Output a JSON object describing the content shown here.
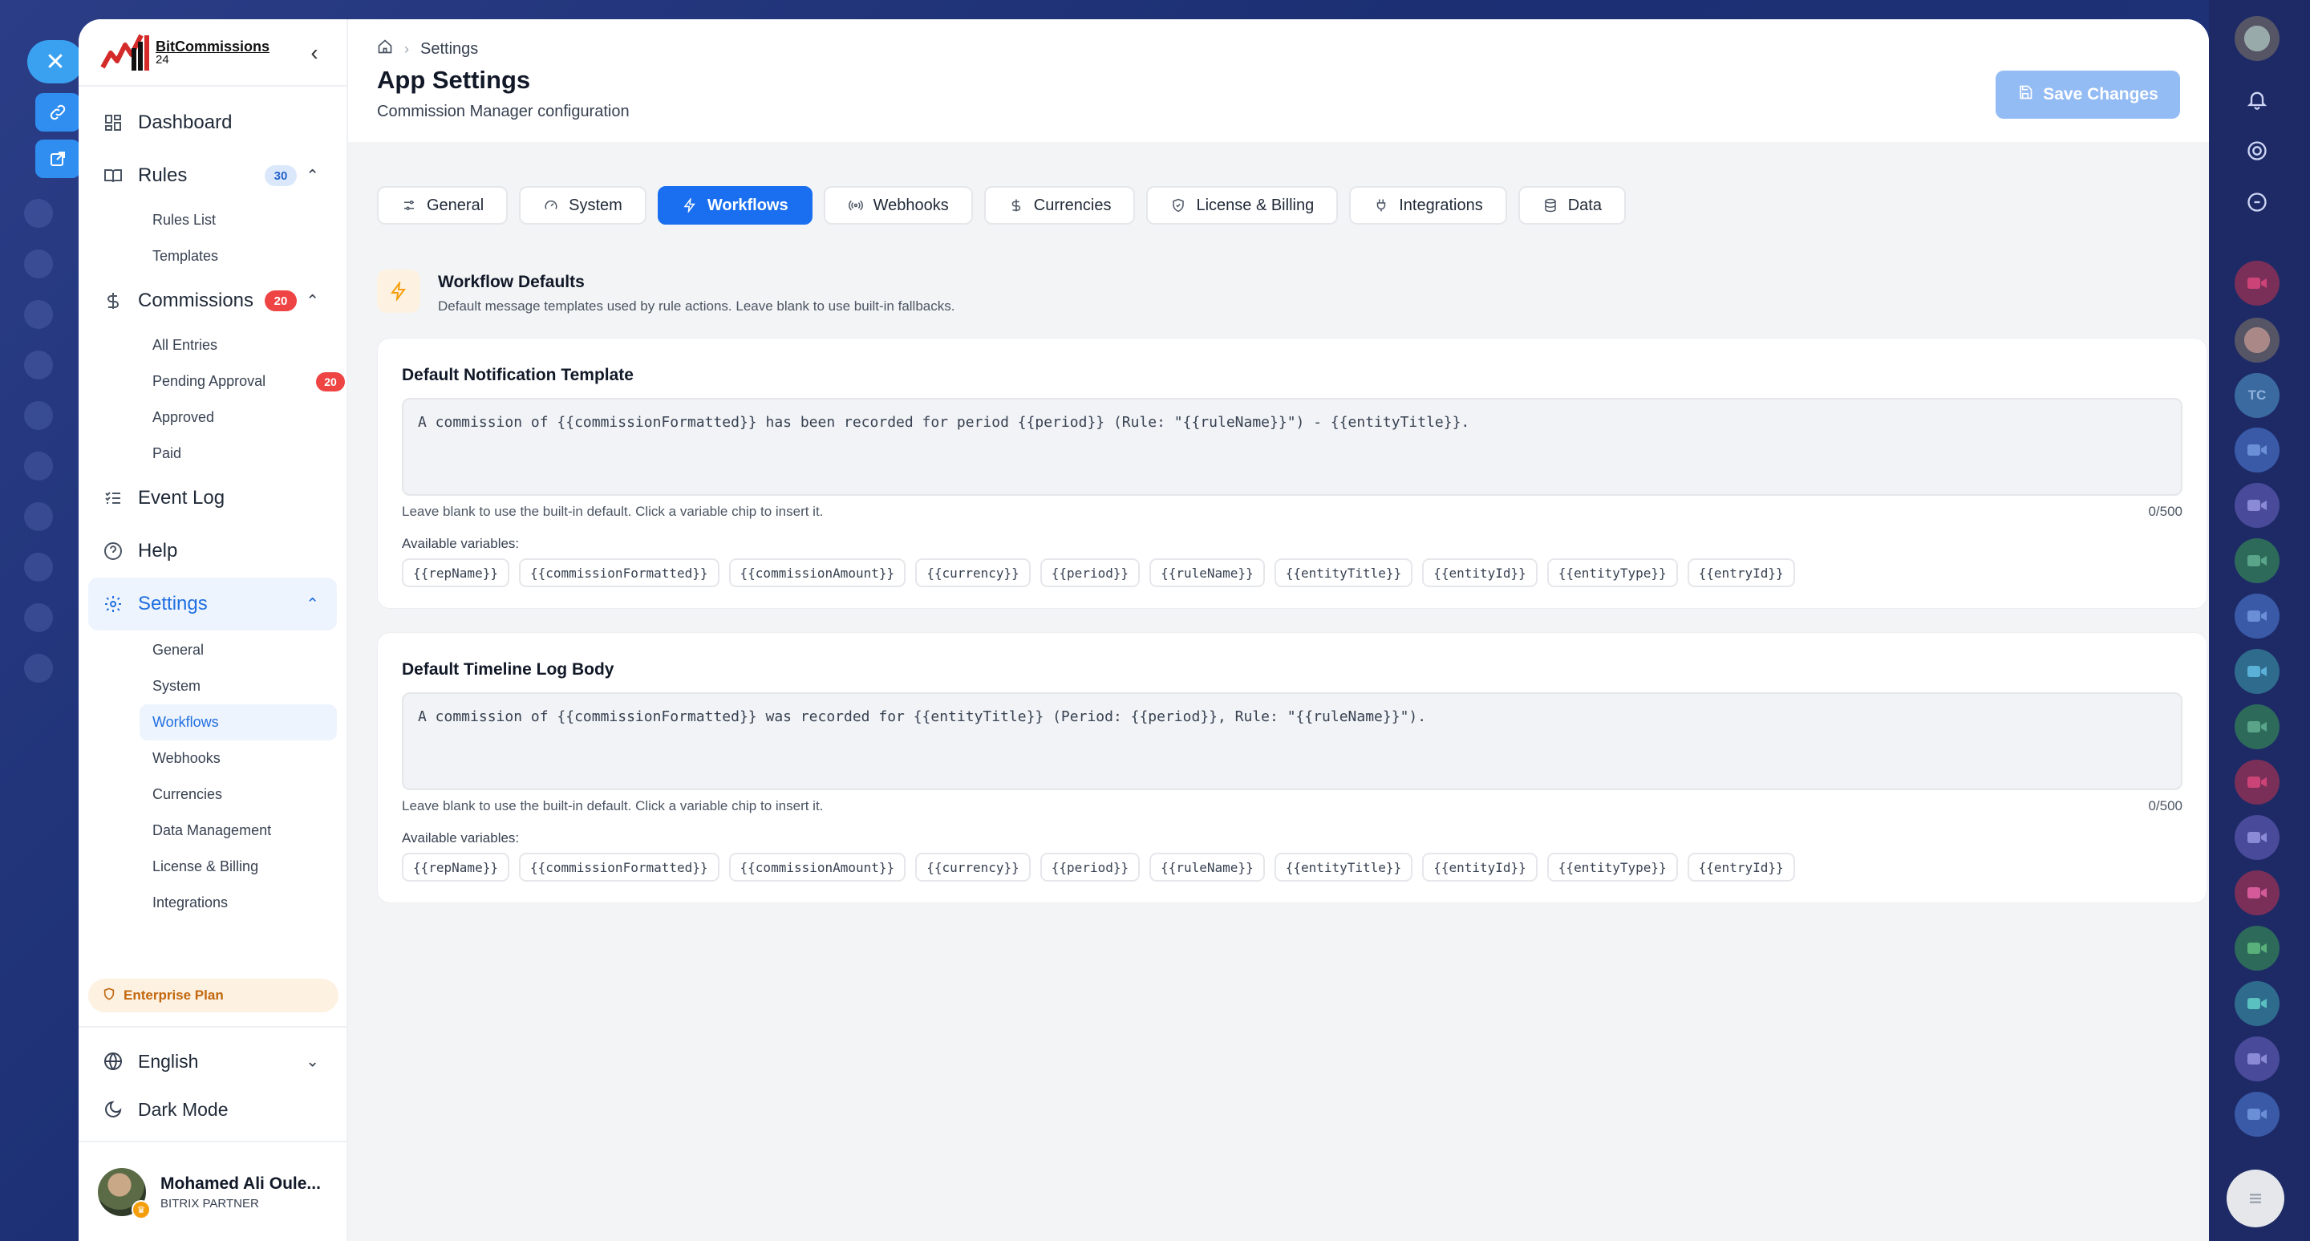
{
  "app": {
    "brand_line1": "BitCommissions",
    "brand_line2": "24"
  },
  "sidebar": {
    "dashboard": "Dashboard",
    "rules": {
      "label": "Rules",
      "badge": "30",
      "items": [
        "Rules List",
        "Templates"
      ]
    },
    "commissions": {
      "label": "Commissions",
      "badge": "20",
      "items": [
        "All Entries",
        "Pending Approval",
        "Approved",
        "Paid"
      ],
      "pending_badge": "20"
    },
    "event_log": "Event Log",
    "help": "Help",
    "settings": {
      "label": "Settings",
      "items": [
        "General",
        "System",
        "Workflows",
        "Webhooks",
        "Currencies",
        "Data Management",
        "License & Billing",
        "Integrations"
      ],
      "active_item": "Workflows"
    },
    "plan": "Enterprise Plan",
    "language": "English",
    "dark_mode": "Dark Mode",
    "user": {
      "name": "Mohamed Ali Oule...",
      "role": "BITRIX PARTNER"
    }
  },
  "header": {
    "breadcrumb": "Settings",
    "title": "App Settings",
    "subtitle": "Commission Manager configuration",
    "save_label": "Save Changes"
  },
  "tabs": [
    "General",
    "System",
    "Workflows",
    "Webhooks",
    "Currencies",
    "License & Billing",
    "Integrations",
    "Data"
  ],
  "active_tab": "Workflows",
  "section": {
    "title": "Workflow Defaults",
    "description": "Default message templates used by rule actions. Leave blank to use built-in fallbacks."
  },
  "cards": [
    {
      "title": "Default Notification Template",
      "value": "A commission of {{commissionFormatted}} has been recorded for period {{period}} (Rule: \"{{ruleName}}\") - {{entityTitle}}.",
      "help": "Leave blank to use the built-in default. Click a variable chip to insert it.",
      "counter": "0/500",
      "vars_label": "Available variables:"
    },
    {
      "title": "Default Timeline Log Body",
      "value": "A commission of {{commissionFormatted}} was recorded for {{entityTitle}} (Period: {{period}}, Rule: \"{{ruleName}}\").",
      "help": "Leave blank to use the built-in default. Click a variable chip to insert it.",
      "counter": "0/500",
      "vars_label": "Available variables:"
    }
  ],
  "variables": [
    "{{repName}}",
    "{{commissionFormatted}}",
    "{{commissionAmount}}",
    "{{currency}}",
    "{{period}}",
    "{{ruleName}}",
    "{{entityTitle}}",
    "{{entityId}}",
    "{{entityType}}",
    "{{entryId}}"
  ],
  "colors": {
    "accent": "#1a6ff0",
    "badge_red": "#ef4444",
    "plan": "#c2670d"
  },
  "right_rail": {
    "tc_initials": "TC"
  }
}
